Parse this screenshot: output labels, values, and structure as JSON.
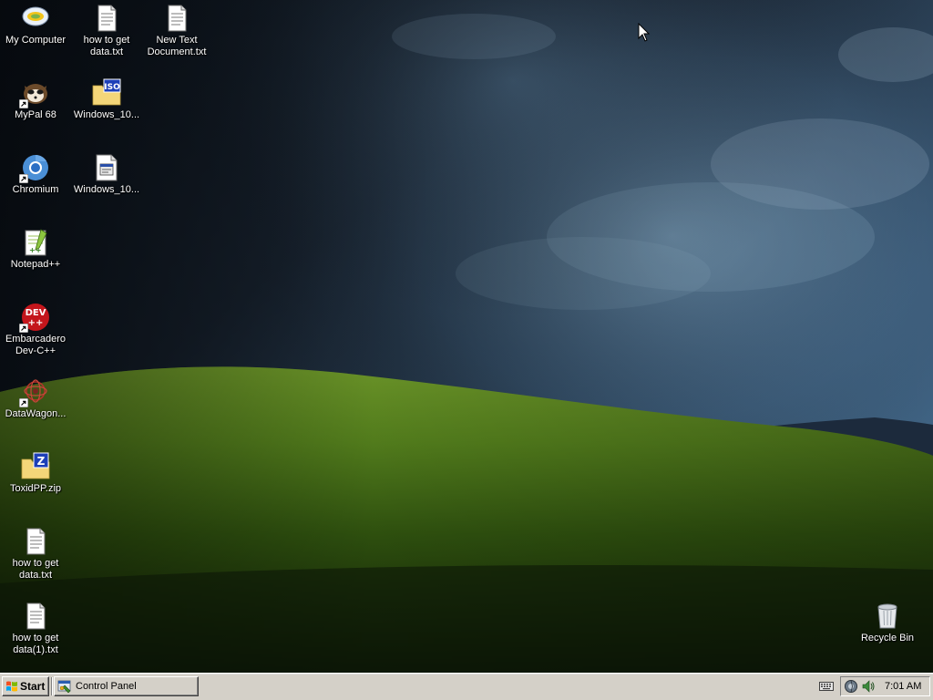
{
  "desktop": {
    "icons": [
      {
        "id": "my-computer",
        "label": "My Computer",
        "icon": "my-computer-icon"
      },
      {
        "id": "how-to-get-data-top",
        "label": "how to get data.txt",
        "icon": "text-file-icon"
      },
      {
        "id": "new-text-document",
        "label": "New Text Document.txt",
        "icon": "text-file-icon"
      },
      {
        "id": "mypal",
        "label": "MyPal 68",
        "icon": "mypal-browser-icon"
      },
      {
        "id": "windows-iso",
        "label": "Windows_10...",
        "icon": "iso-folder-icon"
      },
      {
        "id": "chromium",
        "label": "Chromium",
        "icon": "chromium-icon"
      },
      {
        "id": "windows-file",
        "label": "Windows_10...",
        "icon": "document-file-icon"
      },
      {
        "id": "notepad-plus",
        "label": "Notepad++",
        "icon": "notepad-plus-plus-icon"
      },
      {
        "id": "dev-cpp",
        "label": "Embarcadero Dev-C++",
        "icon": "dev-cpp-icon"
      },
      {
        "id": "datawagon",
        "label": "DataWagon...",
        "icon": "datawagon-icon"
      },
      {
        "id": "toxidpp",
        "label": "ToxidPP.zip",
        "icon": "zip-folder-icon"
      },
      {
        "id": "how-to-get-data-left",
        "label": "how to get data.txt",
        "icon": "text-file-icon"
      },
      {
        "id": "how-to-get-data-1",
        "label": "how to get data(1).txt",
        "icon": "text-file-icon"
      },
      {
        "id": "recycle-bin",
        "label": "Recycle Bin",
        "icon": "recycle-bin-icon"
      }
    ]
  },
  "taskbar": {
    "start_label": "Start",
    "tasks": [
      {
        "label": "Control Panel",
        "icon": "control-panel-icon"
      }
    ],
    "clock": "7:01 AM",
    "tray_icons": [
      "keyboard-icon",
      "network-icon",
      "volume-icon"
    ]
  },
  "colors": {
    "taskbar_bg": "#d4d0c8",
    "desktop_text": "#ffffff"
  }
}
